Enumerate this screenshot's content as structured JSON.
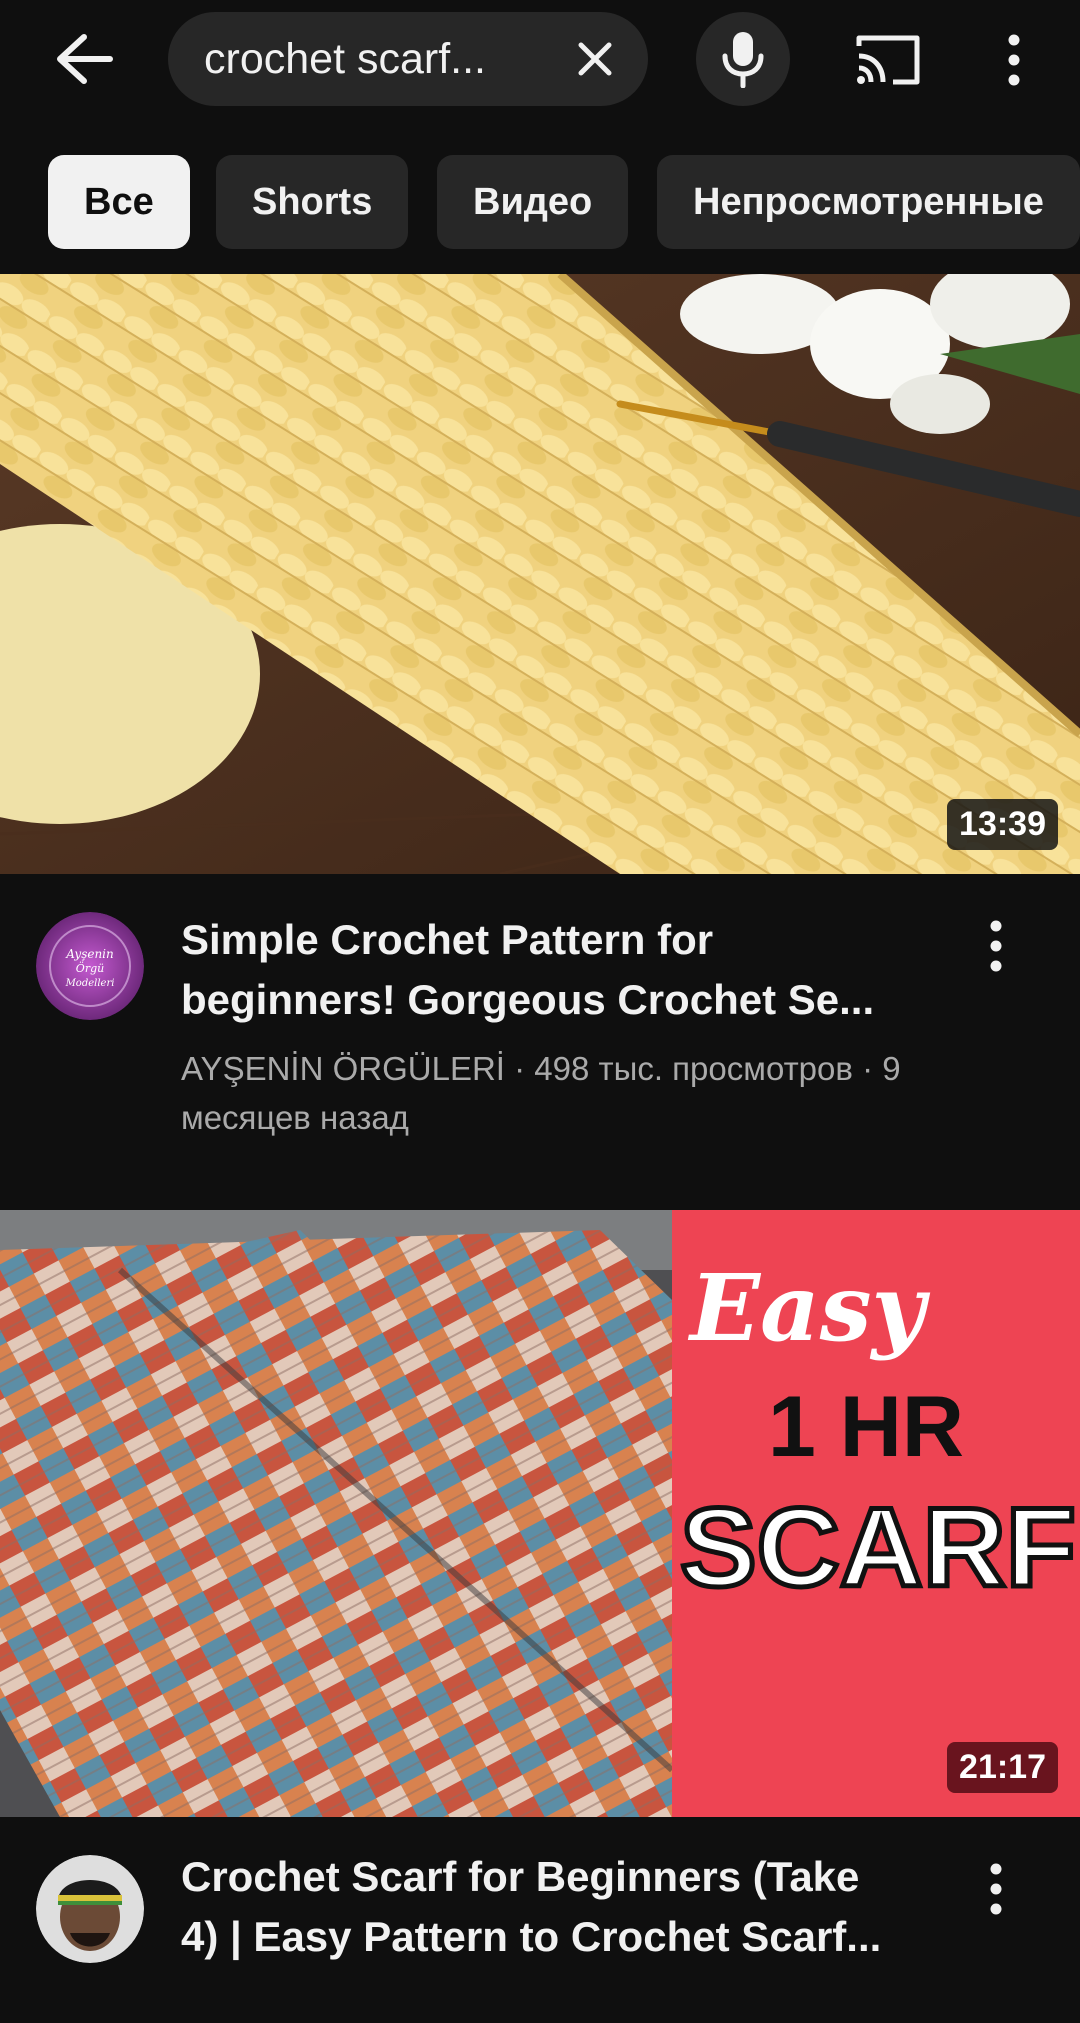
{
  "search": {
    "query": "crochet scarf..."
  },
  "chips": [
    {
      "label": "Все",
      "active": true
    },
    {
      "label": "Shorts",
      "active": false
    },
    {
      "label": "Видео",
      "active": false
    },
    {
      "label": "Непросмотренные",
      "active": false
    }
  ],
  "videos": [
    {
      "title_line1": "Simple Crochet Pattern for",
      "title_line2": "beginners!  Gorgeous Crochet Se...",
      "channel_line1": "AYŞENİN ÖRGÜLERİ · 498 тыс. просмотров · 9",
      "channel_line2": "месяцев назад",
      "duration": "13:39",
      "avatar_text": "Ayşenin Örgü Modelleri"
    },
    {
      "title_line1": "Crochet Scarf for Beginners (Take",
      "title_line2": "4) | Easy Pattern to Crochet Scarf...",
      "duration": "21:17",
      "thumb_text": {
        "easy": "Easy",
        "hr": "1 HR",
        "scarf": "SCARF"
      }
    }
  ],
  "colors": {
    "background": "#0f0f0f",
    "chip": "#272727",
    "chip_active": "#f1f1f1",
    "text_secondary": "#aaaaaa",
    "thumb2_panel": "#ee4453"
  },
  "icons": [
    "back-arrow-icon",
    "close-icon",
    "microphone-icon",
    "cast-icon",
    "more-vertical-icon"
  ]
}
